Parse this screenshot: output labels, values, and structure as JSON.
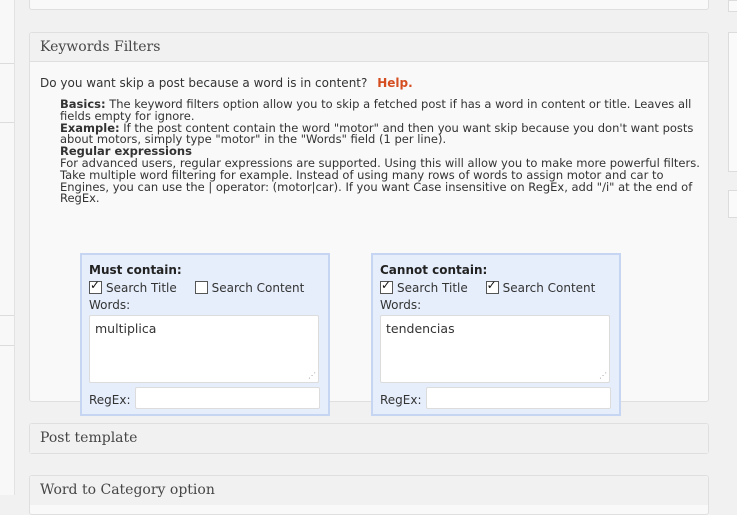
{
  "keywords_filters": {
    "title": "Keywords Filters",
    "question": "Do you want skip a post because a word is in content?",
    "help_label": "Help.",
    "basics_label": "Basics:",
    "basics_text": " The keyword filters option allow you to skip a fetched post if has a word in content or title. Leaves all fields empty for ignore.",
    "example_label": "Example:",
    "example_text": " If the post content contain the word \"motor\" and then you want skip because you don't want posts about motors, simply type \"motor\" in the \"Words\" field (1 per line).",
    "regex_heading": "Regular expressions",
    "regex_text": "For advanced users, regular expressions are supported. Using this will allow you to make more powerful filters. Take multiple word filtering for example. Instead of using many rows of words to assign motor and car to Engines, you can use the | operator: (motor|car). If you want Case insensitive on RegEx, add \"/i\" at the end of RegEx.",
    "must": {
      "title": "Must contain:",
      "search_title_label": "Search Title",
      "search_title_checked": true,
      "search_content_label": "Search Content",
      "search_content_checked": false,
      "words_label": "Words:",
      "words_value": "multiplica",
      "regex_label": "RegEx:",
      "regex_value": ""
    },
    "cannot": {
      "title": "Cannot contain:",
      "search_title_label": "Search Title",
      "search_title_checked": true,
      "search_content_label": "Search Content",
      "search_content_checked": true,
      "words_label": "Words:",
      "words_value": "tendencias",
      "regex_label": "RegEx:",
      "regex_value": ""
    }
  },
  "post_template": {
    "title": "Post template"
  },
  "word_to_category": {
    "title": "Word to Category option"
  },
  "icons": {
    "resize": "resize-grip-icon",
    "checkbox": "checkbox-icon"
  },
  "colors": {
    "help_link": "#d54e21",
    "filter_box_bg": "#e6eefc",
    "filter_box_border": "#c6d6f2"
  }
}
